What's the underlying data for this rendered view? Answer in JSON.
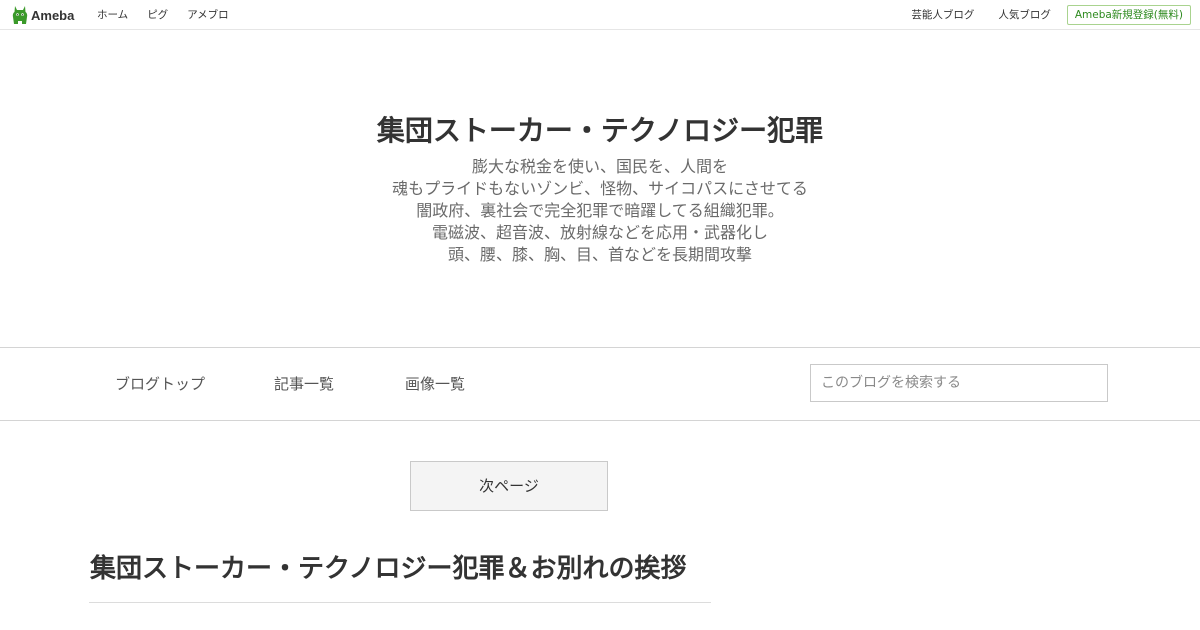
{
  "global_nav": {
    "logo_text": "Ameba",
    "left_links": [
      "ホーム",
      "ピグ",
      "アメブロ"
    ],
    "right_links": [
      "芸能人ブログ",
      "人気ブログ"
    ],
    "register_label": "Ameba新規登録(無料)"
  },
  "blog": {
    "title": "集団ストーカー・テクノロジー犯罪",
    "description_lines": [
      "膨大な税金を使い、国民を、人間を",
      "魂もプライドもないゾンビ、怪物、サイコパスにさせてる",
      "闇政府、裏社会で完全犯罪で暗躍してる組織犯罪。",
      "電磁波、超音波、放射線などを応用・武器化し",
      "頭、腰、膝、胸、目、首などを長期間攻撃"
    ]
  },
  "blog_nav": {
    "items": [
      "ブログトップ",
      "記事一覧",
      "画像一覧"
    ],
    "search_placeholder": "このブログを検索する"
  },
  "pager": {
    "next_label": "次ページ"
  },
  "article": {
    "title": "集団ストーカー・テクノロジー犯罪＆お別れの挨拶"
  },
  "colors": {
    "brand_green": "#2d8a1e",
    "register_border": "#a9d38f"
  }
}
